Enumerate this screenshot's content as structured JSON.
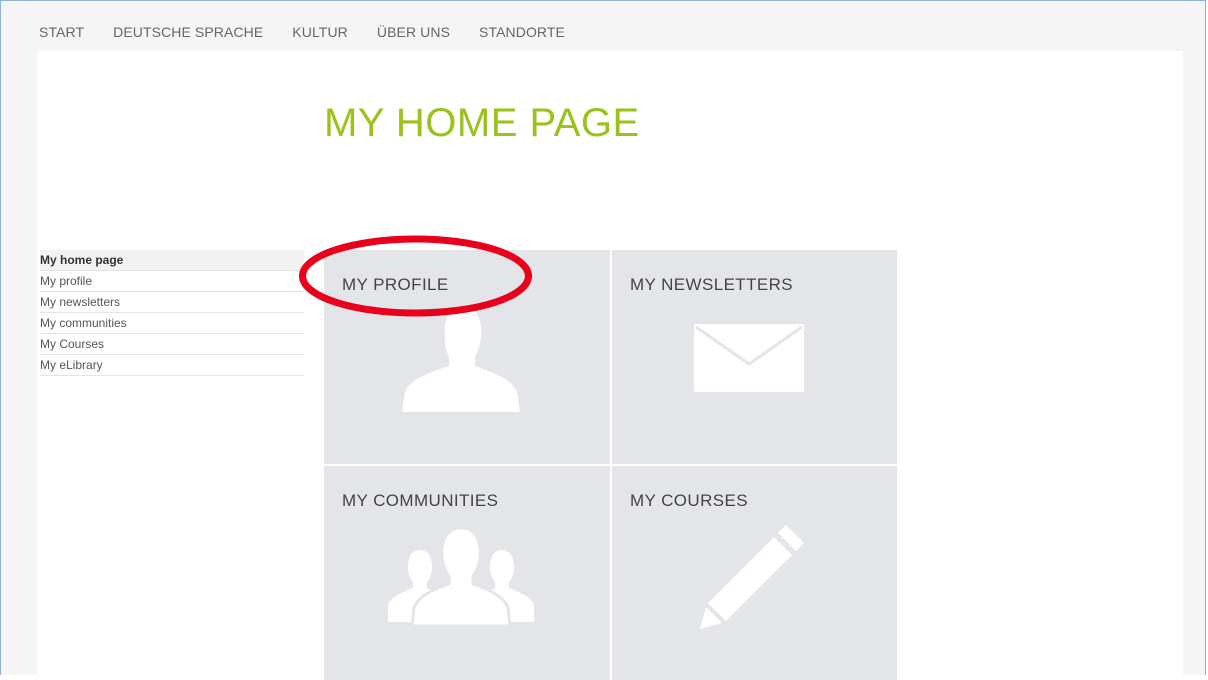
{
  "topnav": {
    "items": [
      "START",
      "DEUTSCHE SPRACHE",
      "KULTUR",
      "ÜBER UNS",
      "STANDORTE"
    ]
  },
  "page": {
    "title": "MY HOME PAGE"
  },
  "sidebar": {
    "items": [
      {
        "label": "My home page",
        "active": true
      },
      {
        "label": "My profile",
        "active": false
      },
      {
        "label": "My newsletters",
        "active": false
      },
      {
        "label": "My communities",
        "active": false
      },
      {
        "label": "My Courses",
        "active": false
      },
      {
        "label": "My eLibrary",
        "active": false
      }
    ]
  },
  "tiles": [
    {
      "label": "MY PROFILE",
      "icon": "person-silhouette-icon"
    },
    {
      "label": "MY NEWSLETTERS",
      "icon": "envelope-icon"
    },
    {
      "label": "MY COMMUNITIES",
      "icon": "group-silhouette-icon"
    },
    {
      "label": "MY COURSES",
      "icon": "pencil-icon"
    }
  ],
  "colors": {
    "title_green": "#99c21a",
    "tile_background": "#e3e5e8",
    "annotation_red": "#e8001c"
  }
}
